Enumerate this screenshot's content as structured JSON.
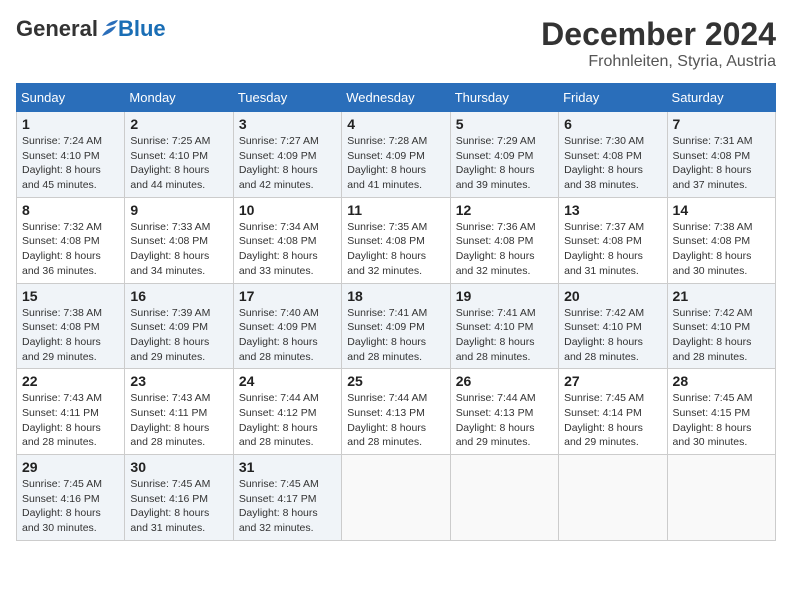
{
  "header": {
    "logo_general": "General",
    "logo_blue": "Blue",
    "month_title": "December 2024",
    "location": "Frohnleiten, Styria, Austria"
  },
  "calendar": {
    "days_of_week": [
      "Sunday",
      "Monday",
      "Tuesday",
      "Wednesday",
      "Thursday",
      "Friday",
      "Saturday"
    ],
    "weeks": [
      [
        null,
        null,
        null,
        null,
        {
          "day": 5,
          "sunrise": "7:29 AM",
          "sunset": "4:09 PM",
          "daylight": "8 hours and 39 minutes."
        },
        {
          "day": 6,
          "sunrise": "7:30 AM",
          "sunset": "4:08 PM",
          "daylight": "8 hours and 38 minutes."
        },
        {
          "day": 7,
          "sunrise": "7:31 AM",
          "sunset": "4:08 PM",
          "daylight": "8 hours and 37 minutes."
        }
      ],
      [
        {
          "day": 1,
          "sunrise": "7:24 AM",
          "sunset": "4:10 PM",
          "daylight": "8 hours and 45 minutes."
        },
        {
          "day": 2,
          "sunrise": "7:25 AM",
          "sunset": "4:10 PM",
          "daylight": "8 hours and 44 minutes."
        },
        {
          "day": 3,
          "sunrise": "7:27 AM",
          "sunset": "4:09 PM",
          "daylight": "8 hours and 42 minutes."
        },
        {
          "day": 4,
          "sunrise": "7:28 AM",
          "sunset": "4:09 PM",
          "daylight": "8 hours and 41 minutes."
        },
        {
          "day": 5,
          "sunrise": "7:29 AM",
          "sunset": "4:09 PM",
          "daylight": "8 hours and 39 minutes."
        },
        {
          "day": 6,
          "sunrise": "7:30 AM",
          "sunset": "4:08 PM",
          "daylight": "8 hours and 38 minutes."
        },
        {
          "day": 7,
          "sunrise": "7:31 AM",
          "sunset": "4:08 PM",
          "daylight": "8 hours and 37 minutes."
        }
      ],
      [
        {
          "day": 8,
          "sunrise": "7:32 AM",
          "sunset": "4:08 PM",
          "daylight": "8 hours and 36 minutes."
        },
        {
          "day": 9,
          "sunrise": "7:33 AM",
          "sunset": "4:08 PM",
          "daylight": "8 hours and 34 minutes."
        },
        {
          "day": 10,
          "sunrise": "7:34 AM",
          "sunset": "4:08 PM",
          "daylight": "8 hours and 33 minutes."
        },
        {
          "day": 11,
          "sunrise": "7:35 AM",
          "sunset": "4:08 PM",
          "daylight": "8 hours and 32 minutes."
        },
        {
          "day": 12,
          "sunrise": "7:36 AM",
          "sunset": "4:08 PM",
          "daylight": "8 hours and 32 minutes."
        },
        {
          "day": 13,
          "sunrise": "7:37 AM",
          "sunset": "4:08 PM",
          "daylight": "8 hours and 31 minutes."
        },
        {
          "day": 14,
          "sunrise": "7:38 AM",
          "sunset": "4:08 PM",
          "daylight": "8 hours and 30 minutes."
        }
      ],
      [
        {
          "day": 15,
          "sunrise": "7:38 AM",
          "sunset": "4:08 PM",
          "daylight": "8 hours and 29 minutes."
        },
        {
          "day": 16,
          "sunrise": "7:39 AM",
          "sunset": "4:09 PM",
          "daylight": "8 hours and 29 minutes."
        },
        {
          "day": 17,
          "sunrise": "7:40 AM",
          "sunset": "4:09 PM",
          "daylight": "8 hours and 28 minutes."
        },
        {
          "day": 18,
          "sunrise": "7:41 AM",
          "sunset": "4:09 PM",
          "daylight": "8 hours and 28 minutes."
        },
        {
          "day": 19,
          "sunrise": "7:41 AM",
          "sunset": "4:10 PM",
          "daylight": "8 hours and 28 minutes."
        },
        {
          "day": 20,
          "sunrise": "7:42 AM",
          "sunset": "4:10 PM",
          "daylight": "8 hours and 28 minutes."
        },
        {
          "day": 21,
          "sunrise": "7:42 AM",
          "sunset": "4:10 PM",
          "daylight": "8 hours and 28 minutes."
        }
      ],
      [
        {
          "day": 22,
          "sunrise": "7:43 AM",
          "sunset": "4:11 PM",
          "daylight": "8 hours and 28 minutes."
        },
        {
          "day": 23,
          "sunrise": "7:43 AM",
          "sunset": "4:11 PM",
          "daylight": "8 hours and 28 minutes."
        },
        {
          "day": 24,
          "sunrise": "7:44 AM",
          "sunset": "4:12 PM",
          "daylight": "8 hours and 28 minutes."
        },
        {
          "day": 25,
          "sunrise": "7:44 AM",
          "sunset": "4:13 PM",
          "daylight": "8 hours and 28 minutes."
        },
        {
          "day": 26,
          "sunrise": "7:44 AM",
          "sunset": "4:13 PM",
          "daylight": "8 hours and 29 minutes."
        },
        {
          "day": 27,
          "sunrise": "7:45 AM",
          "sunset": "4:14 PM",
          "daylight": "8 hours and 29 minutes."
        },
        {
          "day": 28,
          "sunrise": "7:45 AM",
          "sunset": "4:15 PM",
          "daylight": "8 hours and 30 minutes."
        }
      ],
      [
        {
          "day": 29,
          "sunrise": "7:45 AM",
          "sunset": "4:16 PM",
          "daylight": "8 hours and 30 minutes."
        },
        {
          "day": 30,
          "sunrise": "7:45 AM",
          "sunset": "4:16 PM",
          "daylight": "8 hours and 31 minutes."
        },
        {
          "day": 31,
          "sunrise": "7:45 AM",
          "sunset": "4:17 PM",
          "daylight": "8 hours and 32 minutes."
        },
        null,
        null,
        null,
        null
      ]
    ]
  }
}
